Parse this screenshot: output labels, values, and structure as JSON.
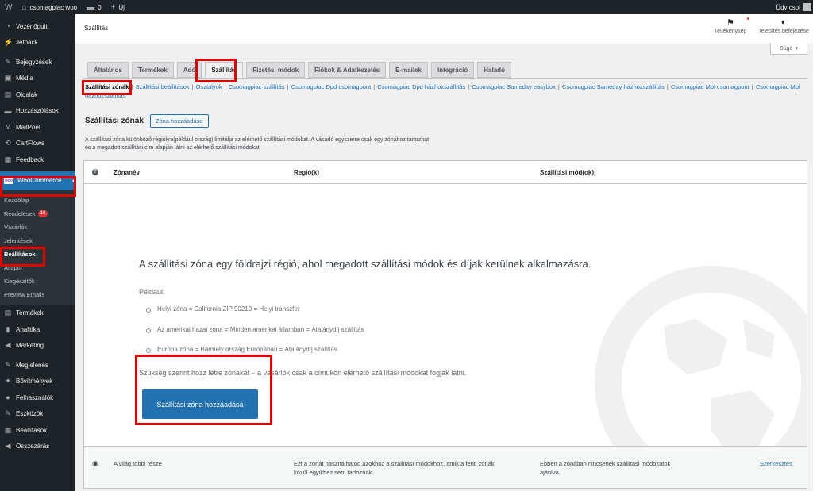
{
  "adminbar": {
    "wp_logo": "W",
    "site_name": "csomagpiac woo",
    "comments_count": "0",
    "new_label": "Új",
    "greeting": "Üdv cspl"
  },
  "sidebar": {
    "top_items": [
      {
        "icon": "dashboard-icon",
        "glyph": "◔",
        "label": "Vezérlőpult"
      },
      {
        "icon": "jetpack-icon",
        "glyph": "⚡",
        "label": "Jetpack"
      },
      {
        "icon": "pin-icon",
        "glyph": "✎",
        "label": "Bejegyzések"
      },
      {
        "icon": "media-icon",
        "glyph": "▣",
        "label": "Média"
      },
      {
        "icon": "page-icon",
        "glyph": "▤",
        "label": "Oldalak"
      },
      {
        "icon": "comment-icon",
        "glyph": "▬",
        "label": "Hozzászólások"
      },
      {
        "icon": "mailpoet-icon",
        "glyph": "M",
        "label": "MailPoet"
      },
      {
        "icon": "cartflows-icon",
        "glyph": "⟲",
        "label": "CartFlows"
      },
      {
        "icon": "feedback-icon",
        "glyph": "▦",
        "label": "Feedback"
      }
    ],
    "woocommerce": {
      "logo": "woo",
      "label": "WooCommerce"
    },
    "submenu": [
      {
        "label": "Kezdőlap"
      },
      {
        "label": "Rendelések",
        "badge": "10"
      },
      {
        "label": "Vásárlók"
      },
      {
        "label": "Jelentések"
      },
      {
        "label": "Beállítások",
        "current": true
      },
      {
        "label": "Állapot"
      },
      {
        "label": "Kiegészítők"
      },
      {
        "label": "Preview Emails"
      }
    ],
    "bottom_items": [
      {
        "icon": "products-icon",
        "glyph": "▤",
        "label": "Termékek"
      },
      {
        "icon": "analytics-icon",
        "glyph": "▮",
        "label": "Analitika"
      },
      {
        "icon": "marketing-icon",
        "glyph": "◀",
        "label": "Marketing"
      },
      {
        "icon": "appearance-icon",
        "glyph": "✎",
        "label": "Megjelenés"
      },
      {
        "icon": "plugins-icon",
        "glyph": "✦",
        "label": "Bővítmények"
      },
      {
        "icon": "users-icon",
        "glyph": "●",
        "label": "Felhasználók"
      },
      {
        "icon": "tools-icon",
        "glyph": "✎",
        "label": "Eszközök"
      },
      {
        "icon": "settings-icon",
        "glyph": "▦",
        "label": "Beállítások"
      },
      {
        "icon": "collapse-icon",
        "glyph": "◀",
        "label": "Összezárás"
      }
    ]
  },
  "header": {
    "title": "Szállítás",
    "activity_label": "Tevékenység",
    "setup_label": "Telepítés befejezése",
    "help_label": "Súgó"
  },
  "tabs": [
    {
      "label": "Általános"
    },
    {
      "label": "Termékek"
    },
    {
      "label": "Adó"
    },
    {
      "label": "Szállítás",
      "active": true
    },
    {
      "label": "Fizetési módok"
    },
    {
      "label": "Fiókok & Adatkezelés"
    },
    {
      "label": "E-mailek"
    },
    {
      "label": "Integráció"
    },
    {
      "label": "Haladó"
    }
  ],
  "subnav": [
    {
      "label": "Szállítási zónák",
      "current": true
    },
    {
      "label": "Szállítási beállítások"
    },
    {
      "label": "Osztályok"
    },
    {
      "label": "Csomagpiac szállítás"
    },
    {
      "label": "Csomagpiac Dpd csomagpont"
    },
    {
      "label": "Csomagpiac Dpd házhozszállítás"
    },
    {
      "label": "Csomagpiac Sameday easybox"
    },
    {
      "label": "Csomagpiac Sameday házhozszállítás"
    },
    {
      "label": "Csomagpiac Mpl csomagpont"
    },
    {
      "label": "Csomagpiac Mpl házhozszállítás"
    }
  ],
  "zones": {
    "title": "Szállítási zónák",
    "add_button": "Zóna hozzáadása",
    "description_1": "A szállítási zóna különböző régiókra(például ország) limitálja az elérhető szállítási módokat. A vásárló egyszerre csak egy zónához tartozhat",
    "description_2": "és a megadott szállítási cím alapján látni az elérhető szállítási módokat."
  },
  "table": {
    "help_glyph": "?",
    "col_name": "Zónanév",
    "col_region": "Regió(k)",
    "col_methods": "Szállítási mód(ok):",
    "blank_title": "A szállítási zóna egy földrajzi régió, ahol megadott szállítási módok és díjak kerülnek alkalmazásra.",
    "example_label": "Például:",
    "examples": [
      "Helyi zóna = California ZIP 90210 = Helyi transzfer",
      "Az amerikai hazai zóna = Minden amerikai államban = Átalánydíj szállítás",
      "Európa zóna = Bármely ország Európában = Átalánydíj szállítás"
    ],
    "note": "Szükség szerint hozz létre zónákat – a vásárlók csak a címükön elérhető szállítási módokat fogják látni.",
    "primary_button": "Szállítási zóna hozzáadása",
    "rest": {
      "globe_glyph": "◉",
      "name": "A világ többi része",
      "region_1": "Ezt a zónát használhatod azokhoz a szállítási módokhoz, amik a fenti zónák",
      "region_2": "közül egyikhez sem tartoznak.",
      "methods_1": "Ebben a zónában nincsenek szállítási módozatok",
      "methods_2": "ajánlva.",
      "edit_link": "Szerkesztés"
    }
  },
  "colors": {
    "highlight": "#e10000",
    "primary": "#2271b1",
    "admin_dark": "#1d2327"
  }
}
